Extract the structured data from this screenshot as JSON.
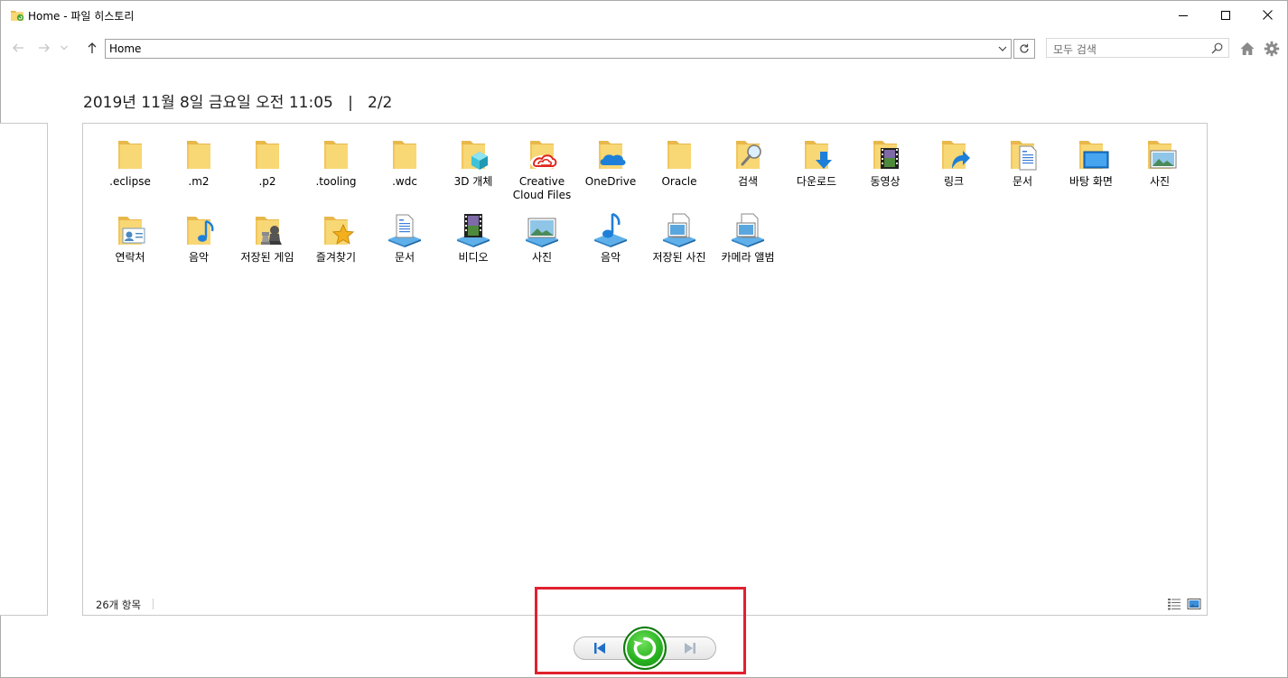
{
  "window": {
    "title": "Home - 파일 히스토리"
  },
  "nav": {
    "address": "Home",
    "search_placeholder": "모두 검색"
  },
  "header": {
    "date": "2019년 11월 8일 금요일 오전 11:05",
    "separator": "|",
    "page": "2/2"
  },
  "items": [
    {
      "label": ".eclipse",
      "icon": "folder-icon"
    },
    {
      "label": ".m2",
      "icon": "folder-icon"
    },
    {
      "label": ".p2",
      "icon": "folder-icon"
    },
    {
      "label": ".tooling",
      "icon": "folder-icon"
    },
    {
      "label": ".wdc",
      "icon": "folder-icon"
    },
    {
      "label": "3D 개체",
      "icon": "folder-3d-objects-icon"
    },
    {
      "label": "Creative Cloud Files",
      "icon": "folder-creative-cloud-icon"
    },
    {
      "label": "OneDrive",
      "icon": "folder-onedrive-icon"
    },
    {
      "label": "Oracle",
      "icon": "folder-icon"
    },
    {
      "label": "검색",
      "icon": "folder-searches-icon"
    },
    {
      "label": "다운로드",
      "icon": "folder-downloads-icon"
    },
    {
      "label": "동영상",
      "icon": "folder-videos-icon"
    },
    {
      "label": "링크",
      "icon": "folder-links-icon"
    },
    {
      "label": "문서",
      "icon": "folder-documents-icon"
    },
    {
      "label": "바탕 화면",
      "icon": "folder-desktop-icon"
    },
    {
      "label": "사진",
      "icon": "folder-pictures-icon"
    },
    {
      "label": "연락처",
      "icon": "folder-contacts-icon"
    },
    {
      "label": "음악",
      "icon": "folder-music-icon"
    },
    {
      "label": "저장된 게임",
      "icon": "folder-saved-games-icon"
    },
    {
      "label": "즐겨찾기",
      "icon": "folder-favorites-icon"
    },
    {
      "label": "문서",
      "icon": "library-documents-icon"
    },
    {
      "label": "비디오",
      "icon": "library-videos-icon"
    },
    {
      "label": "사진",
      "icon": "library-pictures-icon"
    },
    {
      "label": "음악",
      "icon": "library-music-icon"
    },
    {
      "label": "저장된 사진",
      "icon": "library-saved-pictures-icon"
    },
    {
      "label": "카메라 앨범",
      "icon": "library-camera-roll-icon"
    }
  ],
  "status": {
    "count": "26개 항목"
  },
  "colors": {
    "folder": "#f8d775",
    "folder_dark": "#e8b84a",
    "accent_blue": "#1e7fd8",
    "restore_green": "#27b11f",
    "highlight_red": "#e0212f"
  }
}
